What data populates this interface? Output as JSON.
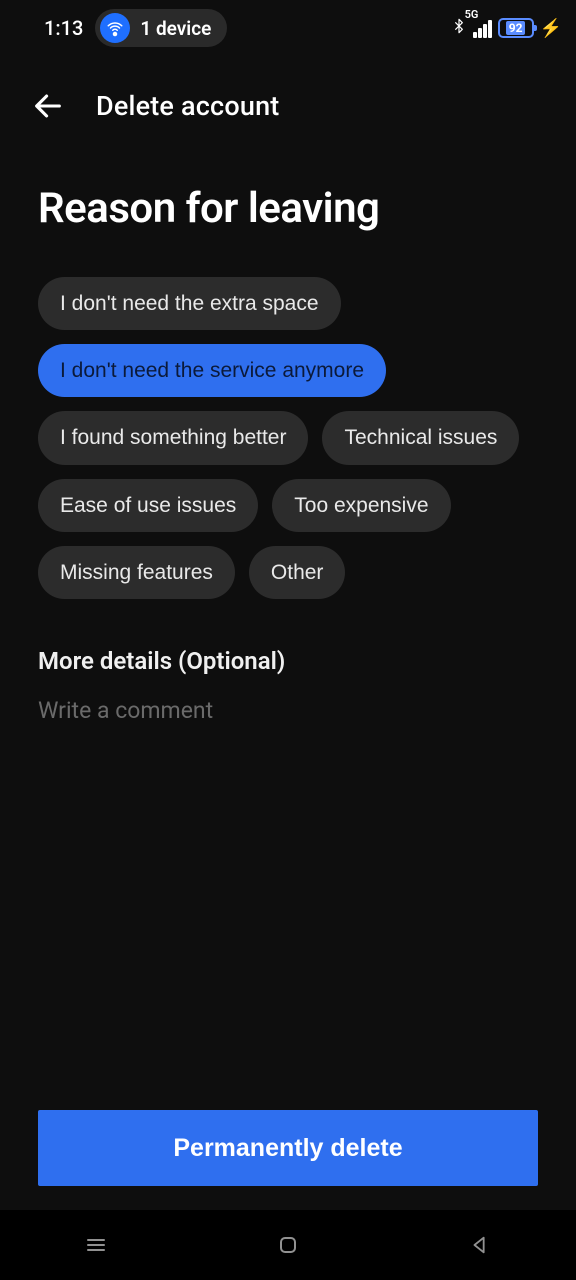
{
  "status": {
    "time": "1:13",
    "device_count_label": "1 device",
    "battery_pct": "92",
    "network_label": "5G"
  },
  "header": {
    "title": "Delete account"
  },
  "page": {
    "heading": "Reason for leaving"
  },
  "reasons": [
    {
      "label": "I don't need the extra space",
      "selected": false
    },
    {
      "label": "I don't need the service anymore",
      "selected": true
    },
    {
      "label": "I found something better",
      "selected": false
    },
    {
      "label": "Technical issues",
      "selected": false
    },
    {
      "label": "Ease of use issues",
      "selected": false
    },
    {
      "label": "Too expensive",
      "selected": false
    },
    {
      "label": "Missing features",
      "selected": false
    },
    {
      "label": "Other",
      "selected": false
    }
  ],
  "details": {
    "label": "More details (Optional)",
    "placeholder": "Write a comment",
    "value": ""
  },
  "footer": {
    "delete_label": "Permanently delete"
  }
}
